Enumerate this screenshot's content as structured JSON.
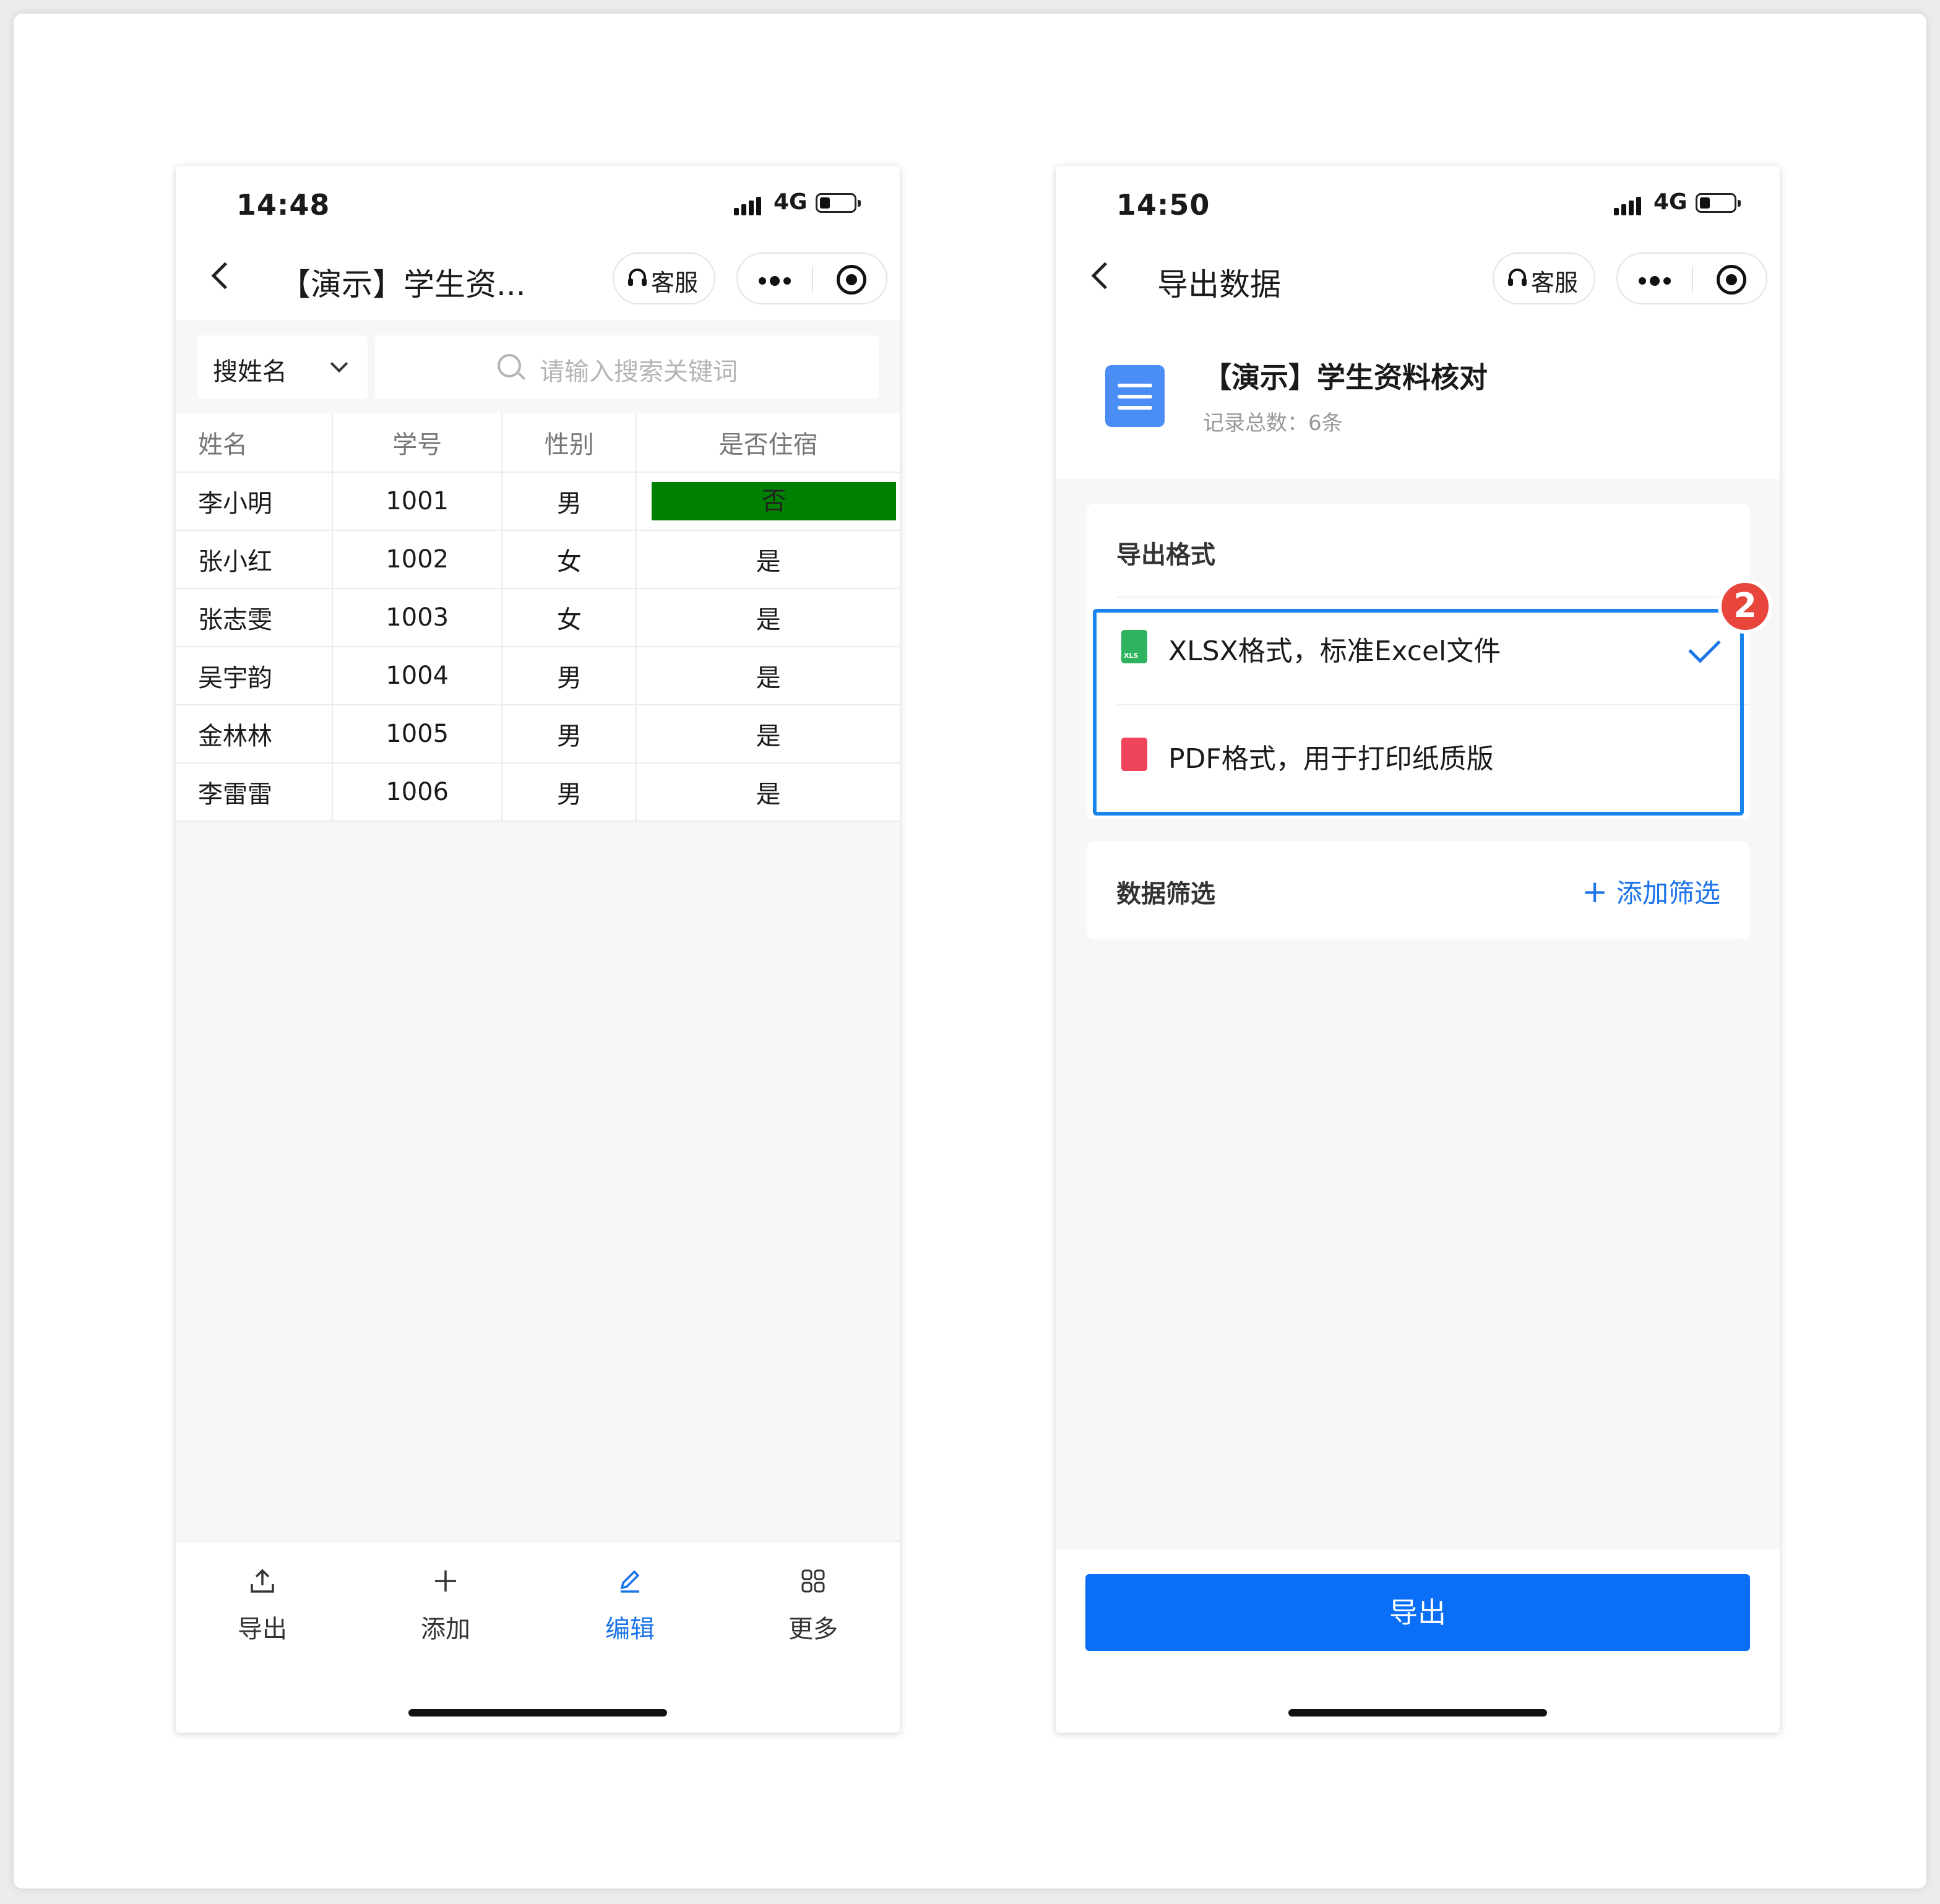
{
  "left": {
    "status": {
      "time": "14:48",
      "network": "4G"
    },
    "nav": {
      "title": "【演示】学生资...",
      "service_label": "客服"
    },
    "search": {
      "field_label": "搜姓名",
      "placeholder": "请输入搜索关键词"
    },
    "table": {
      "headers": [
        "姓名",
        "学号",
        "性别",
        "是否住宿"
      ],
      "rows": [
        [
          "李小明",
          "1001",
          "男",
          "否"
        ],
        [
          "张小红",
          "1002",
          "女",
          "是"
        ],
        [
          "张志雯",
          "1003",
          "女",
          "是"
        ],
        [
          "吴宇韵",
          "1004",
          "男",
          "是"
        ],
        [
          "金林林",
          "1005",
          "男",
          "是"
        ],
        [
          "李雷雷",
          "1006",
          "男",
          "是"
        ]
      ],
      "highlight_color": "#008000"
    },
    "tabs": [
      {
        "label": "导出",
        "icon": "upload-icon"
      },
      {
        "label": "添加",
        "icon": "plus-icon"
      },
      {
        "label": "编辑",
        "icon": "edit-icon",
        "active": true
      },
      {
        "label": "更多",
        "icon": "grid-icon"
      }
    ]
  },
  "right": {
    "status": {
      "time": "14:50",
      "network": "4G"
    },
    "nav": {
      "title": "导出数据",
      "service_label": "客服"
    },
    "doc": {
      "title": "【演示】学生资料核对",
      "subtitle": "记录总数：6条"
    },
    "format": {
      "title": "导出格式",
      "options": [
        {
          "label": "XLSX格式，标准Excel文件",
          "icon": "xls-file-icon",
          "icon_text": "XLS",
          "selected": true
        },
        {
          "label": "PDF格式，用于打印纸质版",
          "icon": "pdf-file-icon",
          "selected": false
        }
      ]
    },
    "step_badge": "2",
    "filter": {
      "title": "数据筛选",
      "add_label": "添加筛选"
    },
    "export_button": "导出"
  },
  "colors": {
    "accent": "#1a73e8",
    "primary_button": "#0a6ff6",
    "badge": "#e8453c"
  }
}
